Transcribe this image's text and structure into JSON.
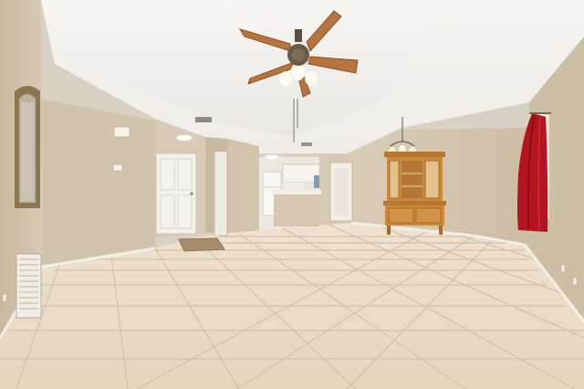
{
  "scene": {
    "kind": "interior-room-photo",
    "description_items": [
      "ceiling-fan",
      "pendant-chandelier",
      "china-hutch",
      "wall-mirror",
      "front-door",
      "kitchen-opening",
      "tile-floor",
      "red-curtain"
    ]
  },
  "colors": {
    "ceiling": "#f1efeb",
    "wall": "#d6c7b1",
    "wall_shadow": "#c4b39b",
    "floor": "#eadbc6",
    "floor_grout": "#c9b79f",
    "baseboard": "#f4f1ea",
    "door": "#f3f1ec",
    "wood": "#c98a3e",
    "wood_dark": "#a86a26",
    "fan_blade": "#b8743f",
    "curtain": "#b3151f",
    "mirror_frame": "#8c7650"
  }
}
